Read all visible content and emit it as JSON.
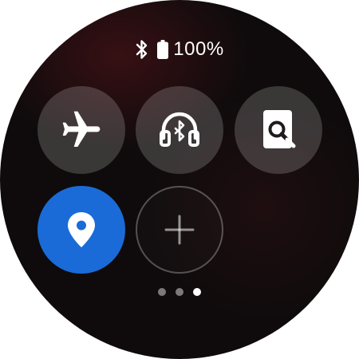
{
  "status_bar": {
    "bluetooth_icon": "bluetooth-icon",
    "battery_icon": "battery-full-icon",
    "battery_percent": "100%"
  },
  "quick_tiles": [
    {
      "id": "airplane-mode",
      "icon": "airplane-icon",
      "active": false
    },
    {
      "id": "bluetooth-audio",
      "icon": "bluetooth-headphones-icon",
      "active": false
    },
    {
      "id": "find-my-phone",
      "icon": "find-phone-icon",
      "active": false
    },
    {
      "id": "location",
      "icon": "location-pin-icon",
      "active": true
    },
    {
      "id": "add-tile",
      "icon": "plus-icon",
      "active": false
    }
  ],
  "pager": {
    "page_count": 3,
    "current_page": 3
  },
  "colors": {
    "active_tile": "#1a6bd8",
    "tile_background": "#3a3637",
    "watch_background": "#0f0b0c"
  }
}
